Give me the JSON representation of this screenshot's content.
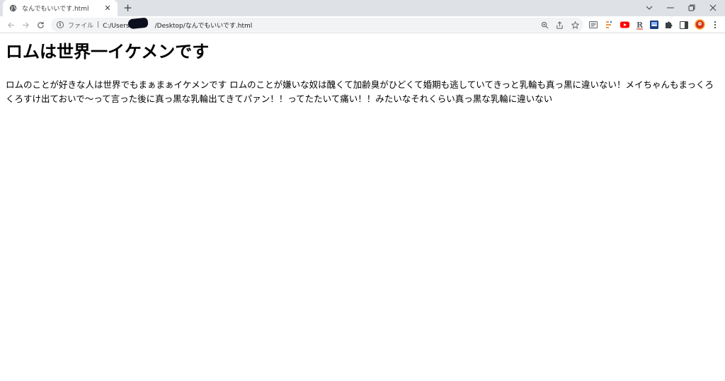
{
  "tab": {
    "title": "なんでもいいです.html",
    "favicon": "globe-icon",
    "close": "✕",
    "new_tab": "+"
  },
  "window_controls": [
    "chevron-down-icon",
    "minimize-icon",
    "restore-icon",
    "close-icon"
  ],
  "toolbar": {
    "back": "back-arrow-icon",
    "forward": "forward-arrow-icon",
    "reload": "reload-icon"
  },
  "omnibox": {
    "scheme_label": "ファイル",
    "separator": "|",
    "url_prefix": "C:/Users",
    "url_suffix": "/Desktop/なんでもいいです.html",
    "icons": [
      "zoom-icon",
      "share-icon",
      "bookmark-star-icon"
    ]
  },
  "extensions": [
    "reading-list-icon",
    "extension-a-icon",
    "youtube-icon",
    "extension-r-icon",
    "extension-photo-icon",
    "puzzle-icon",
    "side-panel-icon",
    "profile-avatar-icon",
    "menu-kebab-icon"
  ],
  "page": {
    "heading": "ロムは世界一イケメンです",
    "paragraph": "ロムのことが好きな人は世界でもまぁまぁイケメンです ロムのことが嫌いな奴は醜くて加齢臭がひどくて婚期も逃していてきっと乳輪も真っ黒に違いない！メイちゃんもまっくろくろすけ出ておいで～って言った後に真っ黒な乳輪出てきてパァン！！ってたたいて痛い！！みたいなそれくらい真っ黒な乳輪に違いない"
  },
  "colors": {
    "tabstrip": "#dee1e6",
    "omnibox": "#f1f3f4",
    "youtube_red": "#ff0000"
  }
}
